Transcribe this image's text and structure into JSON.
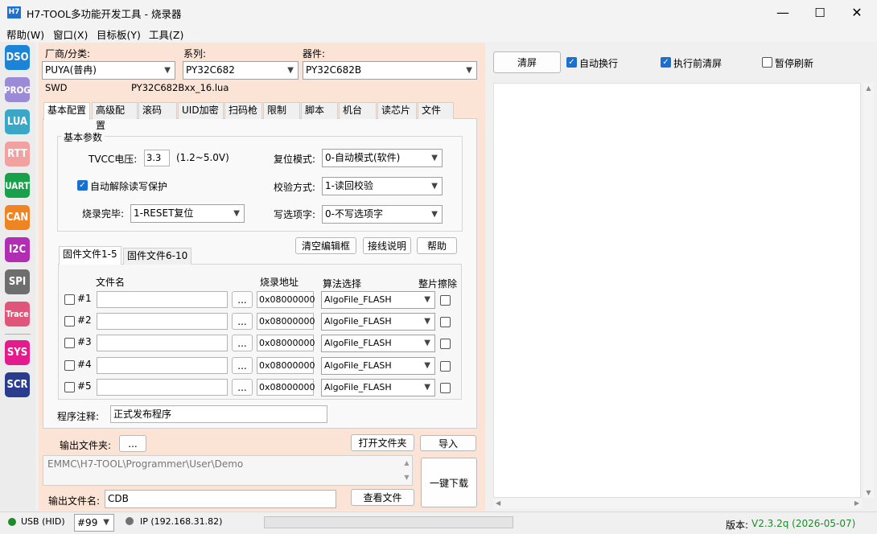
{
  "title": {
    "logo": "H7",
    "text": "H7-TOOL多功能开发工具 - 烧录器"
  },
  "winctl": {
    "min": "—",
    "max": "☐",
    "close": "✕"
  },
  "menu": [
    "帮助(W)",
    "窗口(X)",
    "目标板(Y)",
    "工具(Z)"
  ],
  "sidebar": [
    {
      "label": "DSO",
      "color": "#1b84d8"
    },
    {
      "label": "PROG",
      "color": "#9b8bd6"
    },
    {
      "label": "LUA",
      "color": "#3aa7c7"
    },
    {
      "label": "RTT",
      "color": "#f2a1a1"
    },
    {
      "label": "UART",
      "color": "#19a04a"
    },
    {
      "label": "CAN",
      "color": "#f08322"
    },
    {
      "label": "I2C",
      "color": "#b02db4"
    },
    {
      "label": "SPI",
      "color": "#6e6e6e"
    },
    {
      "label": "Trace",
      "color": "#e0557a"
    },
    {
      "label": "SYS",
      "color": "#e51a8c"
    },
    {
      "label": "SCR",
      "color": "#2a3c8e"
    }
  ],
  "target": {
    "vendor_label": "厂商/分类:",
    "vendor": "PUYA(普冉)",
    "series_label": "系列:",
    "series": "PY32C682",
    "device_label": "器件:",
    "device": "PY32C682B",
    "iface": "SWD",
    "lua": "PY32C682Bxx_16.lua"
  },
  "tabs": [
    "基本配置",
    "高级配置",
    "滚码",
    "UID加密",
    "扫码枪",
    "限制",
    "脚本",
    "机台",
    "读芯片",
    "文件"
  ],
  "basic": {
    "group": "基本参数",
    "tvcc_label": "TVCC电压:",
    "tvcc": "3.3",
    "tvcc_range": "(1.2~5.0V)",
    "auto_unprotect": "自动解除读写保护",
    "finish_label": "烧录完毕:",
    "finish": "1-RESET复位",
    "reset_label": "复位模式:",
    "reset": "0-自动模式(软件)",
    "verify_label": "校验方式:",
    "verify": "1-读回校验",
    "opt_label": "写选项字:",
    "opt": "0-不写选项字"
  },
  "actions": {
    "clear_editor": "清空编辑框",
    "wiring": "接线说明",
    "help": "帮助"
  },
  "ftabs": [
    "固件文件1-5",
    "固件文件6-10"
  ],
  "fhead": {
    "name": "文件名",
    "addr": "烧录地址",
    "algo": "算法选择",
    "erase": "整片擦除"
  },
  "files": [
    {
      "id": "#1",
      "addr": "0x08000000",
      "algo": "AlgoFile_FLASH"
    },
    {
      "id": "#2",
      "addr": "0x08000000",
      "algo": "AlgoFile_FLASH"
    },
    {
      "id": "#3",
      "addr": "0x08000000",
      "algo": "AlgoFile_FLASH"
    },
    {
      "id": "#4",
      "addr": "0x08000000",
      "algo": "AlgoFile_FLASH"
    },
    {
      "id": "#5",
      "addr": "0x08000000",
      "algo": "AlgoFile_FLASH"
    }
  ],
  "browse": "...",
  "note_label": "程序注释:",
  "note": "正式发布程序",
  "out": {
    "folder_label": "输出文件夹:",
    "browse": "...",
    "open_folder": "打开文件夹",
    "import": "导入",
    "path": "EMMC\\H7-TOOL\\Programmer\\User\\Demo",
    "download": "一键下载",
    "name_label": "输出文件名:",
    "name": "CDB",
    "view": "查看文件"
  },
  "right": {
    "clear": "清屏",
    "autowrap": "自动换行",
    "clear_before": "执行前清屏",
    "pause": "暂停刷新"
  },
  "status": {
    "usb": "USB (HID)",
    "port": "#99",
    "ip": "IP (192.168.31.82)",
    "version_label": "版本:",
    "version": "V2.3.2q (2026-05-07)"
  },
  "colors": {
    "accent": "#1a6fcf",
    "panel": "#fbe3d6",
    "usb_dot": "#1f8a2a",
    "version": "#1f8a2a"
  }
}
